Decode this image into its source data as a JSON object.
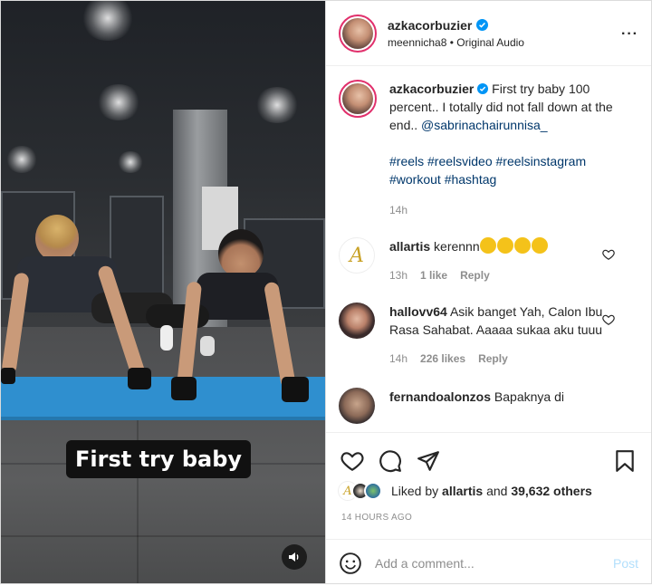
{
  "video": {
    "caption_overlay": "First try baby",
    "mute_icon": "speaker-icon"
  },
  "header": {
    "username": "azkacorbuzier",
    "audio_line": "meennicha8 • Original Audio",
    "more": "···"
  },
  "caption": {
    "username": "azkacorbuzier",
    "text": "First try baby 100 percent.. I totally did not fall down at the end..",
    "mention": "@sabrinachairunnisa_",
    "hashtags_line1": "#reels #reelsvideo #reelsinstagram",
    "hashtags_line2": "#workout #hashtag",
    "time": "14h"
  },
  "comments": [
    {
      "username": "allartis",
      "text": "kerennn",
      "time": "13h",
      "likes": "1 like",
      "reply": "Reply"
    },
    {
      "username": "hallovv64",
      "text": "Asik banget Yah, Calon Ibu Rasa Sahabat. Aaaaa sukaa aku tuuu",
      "time": "14h",
      "likes": "226 likes",
      "reply": "Reply"
    },
    {
      "username": "fernandoalonzos",
      "text": "Bapaknya di"
    }
  ],
  "likes": {
    "prefix": "Liked by ",
    "user": "allartis",
    "middle": " and ",
    "count": "39,632 others"
  },
  "timestamp": "14 HOURS AGO",
  "add_comment": {
    "placeholder": "Add a comment...",
    "post_label": "Post"
  },
  "colors": {
    "verified": "#0095f6",
    "link": "#00376b",
    "post_disabled": "#b2dffc"
  }
}
